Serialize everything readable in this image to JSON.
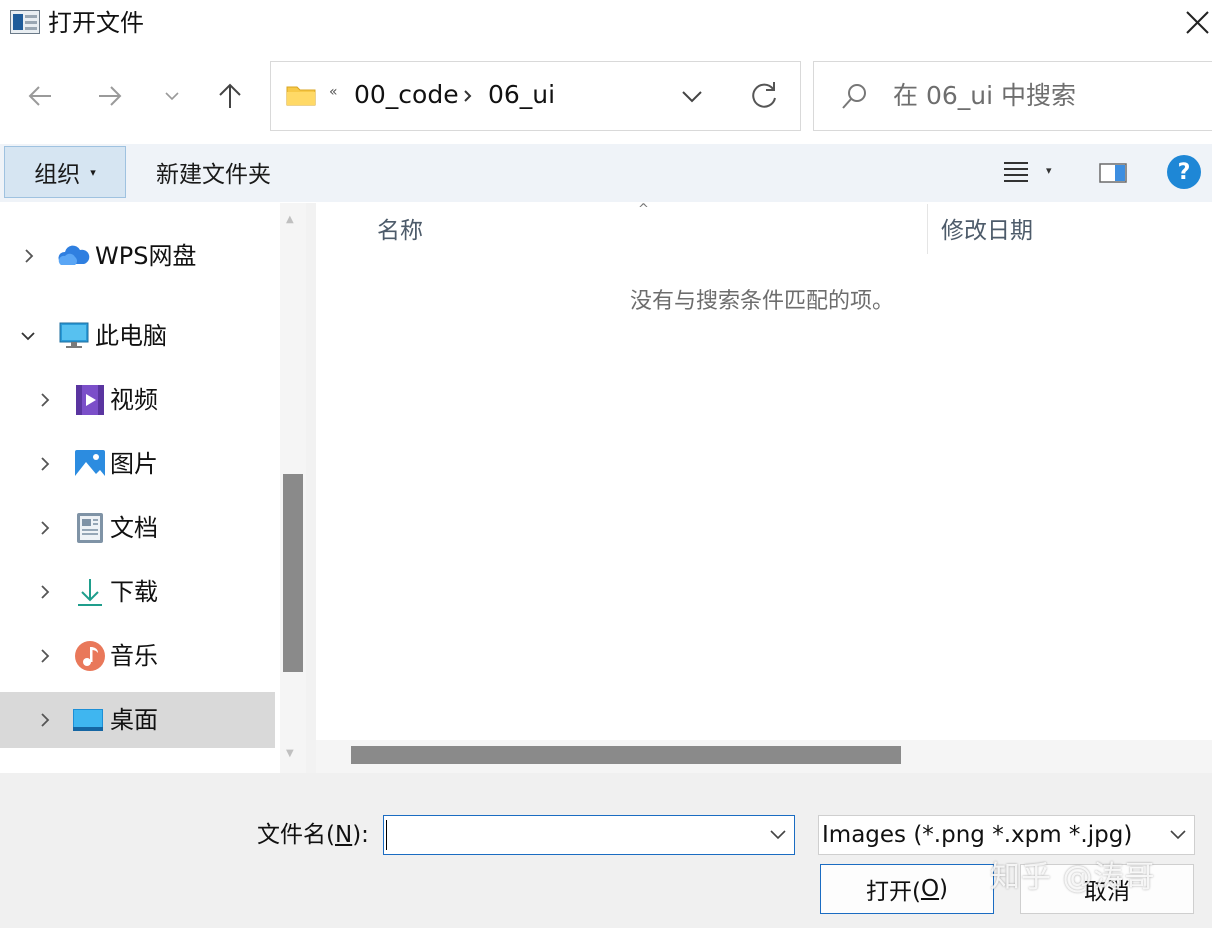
{
  "window": {
    "title": "打开文件",
    "close_icon": "close-icon"
  },
  "nav": {
    "back_icon": "arrow-left-icon",
    "forward_icon": "arrow-right-icon",
    "recent_icon": "chevron-down-icon",
    "up_icon": "arrow-up-icon"
  },
  "address": {
    "overflow": "«",
    "breadcrumbs": [
      "00_code",
      "06_ui"
    ],
    "dropdown_icon": "chevron-down-icon",
    "refresh_icon": "refresh-icon"
  },
  "search": {
    "placeholder": "在 06_ui 中搜索",
    "icon": "search-icon"
  },
  "toolbar": {
    "organize_label": "组织",
    "organize_caret": "▾",
    "new_folder_label": "新建文件夹",
    "view_caret": "▾",
    "help_label": "?"
  },
  "tree": [
    {
      "label": "WPS网盘",
      "icon": "cloud-icon",
      "expanded": false
    },
    {
      "label": "此电脑",
      "icon": "computer-icon",
      "expanded": true
    },
    {
      "label": "视频",
      "icon": "video-icon",
      "expanded": false
    },
    {
      "label": "图片",
      "icon": "pictures-icon",
      "expanded": false
    },
    {
      "label": "文档",
      "icon": "documents-icon",
      "expanded": false
    },
    {
      "label": "下载",
      "icon": "download-icon",
      "expanded": false
    },
    {
      "label": "音乐",
      "icon": "music-icon",
      "expanded": false
    },
    {
      "label": "桌面",
      "icon": "desktop-icon",
      "expanded": false,
      "selected": true
    }
  ],
  "filelist": {
    "columns": [
      "名称",
      "修改日期"
    ],
    "sort_indicator": "^",
    "empty_message": "没有与搜索条件匹配的项。"
  },
  "footer": {
    "filename_label_pre": "文件名(",
    "filename_label_key": "N",
    "filename_label_post": "):",
    "filename_value": "",
    "filetype_value": "Images (*.png *.xpm *.jpg)",
    "open_label_pre": "打开(",
    "open_label_key": "O",
    "open_label_post": ")",
    "cancel_label": "取消",
    "watermark": "知乎 @涛哥"
  },
  "colors": {
    "accent": "#1b6cc2",
    "selected_row": "#d9d9d9",
    "toolbar_bg": "#eff3f8"
  }
}
